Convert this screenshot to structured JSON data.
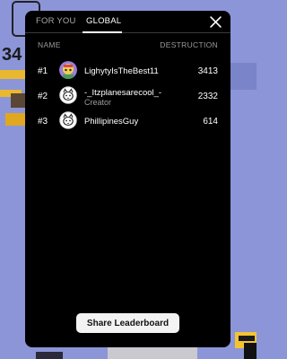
{
  "tabs": [
    {
      "label": "FOR YOU",
      "active": false
    },
    {
      "label": "GLOBAL",
      "active": true
    }
  ],
  "columns": {
    "name": "NAME",
    "destruction": "DESTRUCTION"
  },
  "leaderboard": [
    {
      "rank": "#1",
      "name": "LighytyIsTheBest11",
      "tag": "",
      "score": "3413",
      "avatar": "colorful-avatar-icon"
    },
    {
      "rank": "#2",
      "name": "-_Itzplanesarecool_-",
      "tag": "Creator",
      "score": "2332",
      "avatar": "cat-avatar-icon"
    },
    {
      "rank": "#3",
      "name": "PhillipinesGuy",
      "tag": "",
      "score": "614",
      "avatar": "cat-avatar-icon"
    }
  ],
  "share_label": "Share Leaderboard",
  "background": {
    "partial_number": "34",
    "colors": {
      "sky": "#8b95d8",
      "panel": "#000000",
      "accent_yellow": "#f4c430"
    }
  }
}
